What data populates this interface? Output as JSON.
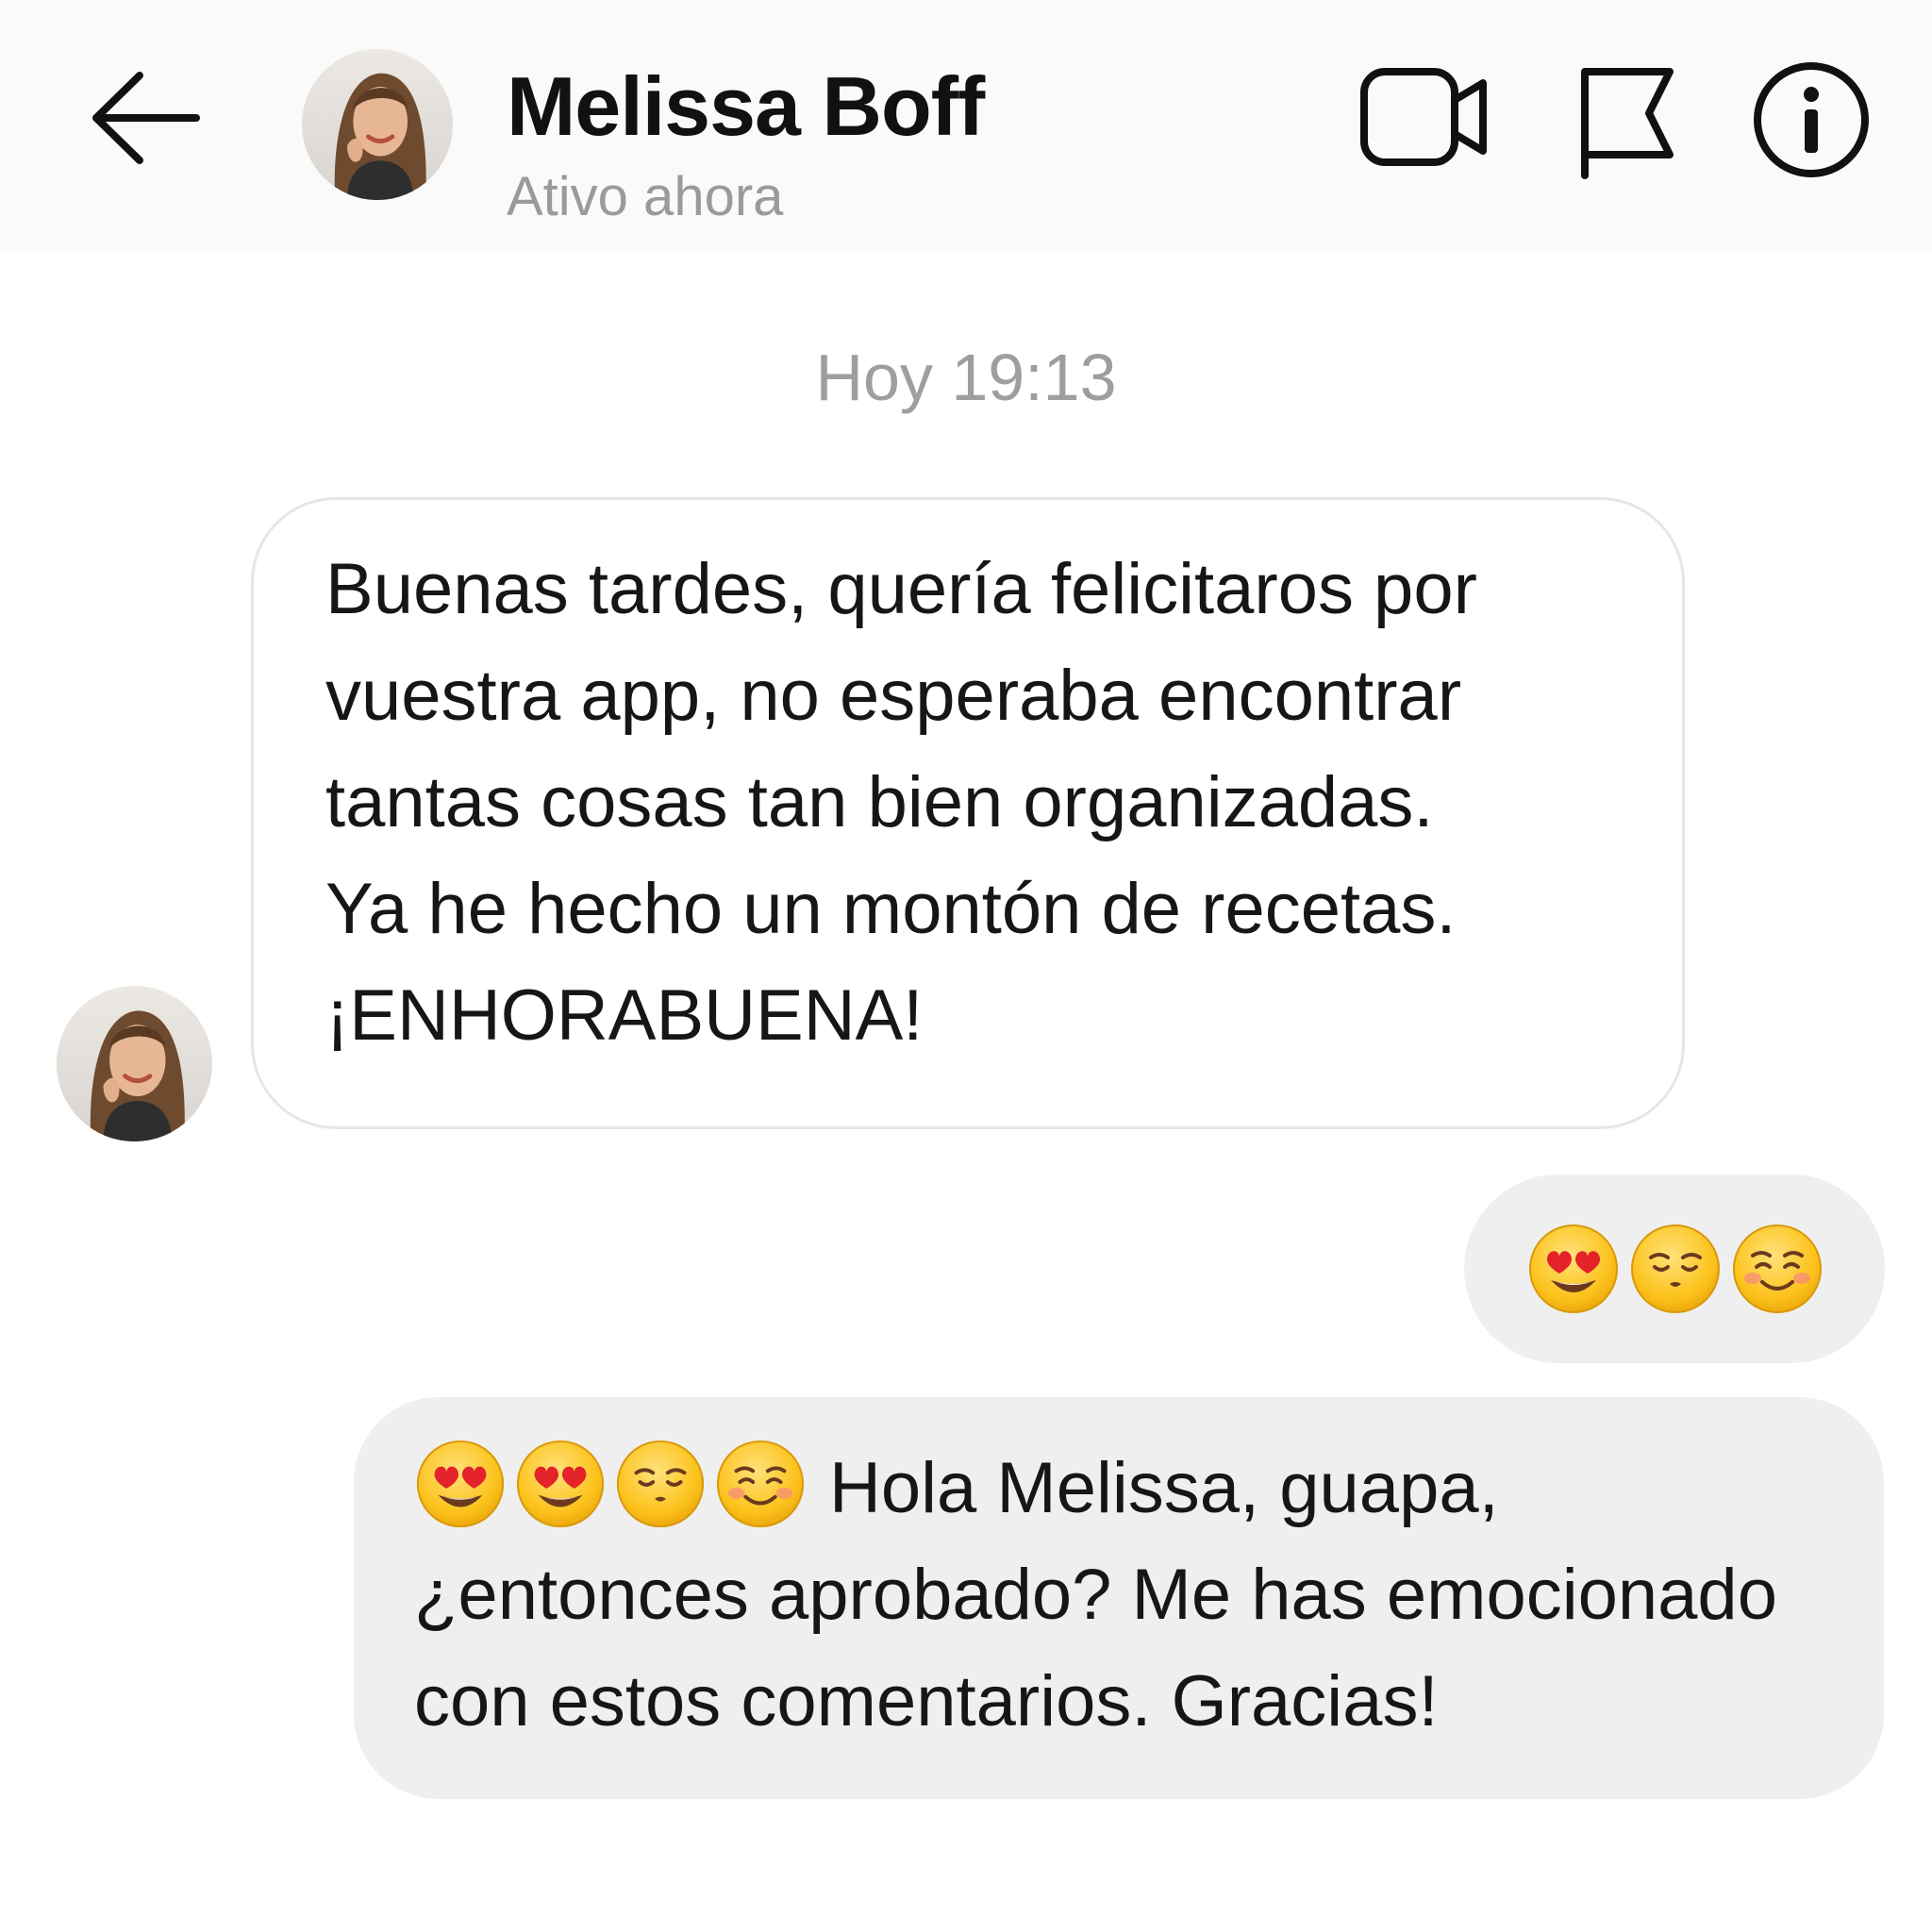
{
  "header": {
    "contact_name": "Melissa Boff",
    "status": "Ativo ahora",
    "icons": [
      "back-arrow-icon",
      "video-call-icon",
      "flag-icon",
      "info-icon"
    ]
  },
  "chat": {
    "timestamp": "Hoy 19:13",
    "incoming_message": {
      "lines": [
        "Buenas tardes, quería felicitaros por",
        "vuestra app, no esperaba encontrar",
        "tantas cosas tan bien organizadas.",
        "Ya he hecho un montón de recetas.",
        "¡ENHORABUENA!"
      ]
    },
    "outgoing_emoji_message": {
      "emojis": [
        "😍",
        "😚",
        "☺️"
      ]
    },
    "outgoing_text_message": {
      "emojis": [
        "😍",
        "😍",
        "😙",
        "☺️"
      ],
      "lines": [
        "Hola Melissa, guapa,",
        "¿entonces aprobado? Me has emocionado",
        "con estos comentarios. Gracias!"
      ]
    }
  },
  "colors": {
    "header_bg": "#fafafa",
    "outgoing_bubble": "#efefef",
    "incoming_border": "#e6e6e6",
    "muted_text": "#9e9e9e",
    "emoji_yellow": "#fcc21b"
  }
}
